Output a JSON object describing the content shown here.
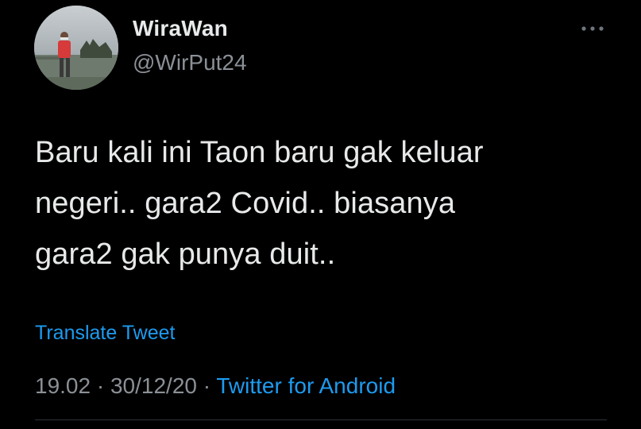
{
  "author": {
    "display_name": "WiraWan",
    "handle": "@WirPut24"
  },
  "tweet": {
    "text": "Baru kali ini Taon baru gak keluar\nnegeri.. gara2 Covid.. biasanya\ngara2 gak punya duit..",
    "translate_label": "Translate Tweet",
    "time": "19.02",
    "date": "30/12/20",
    "separator": "·",
    "source": "Twitter for Android"
  },
  "icons": {
    "more": "more-options-icon"
  },
  "colors": {
    "background": "#000000",
    "primary_text": "#e7e9ea",
    "secondary_text": "#8b9096",
    "link": "#1d9bf0"
  }
}
